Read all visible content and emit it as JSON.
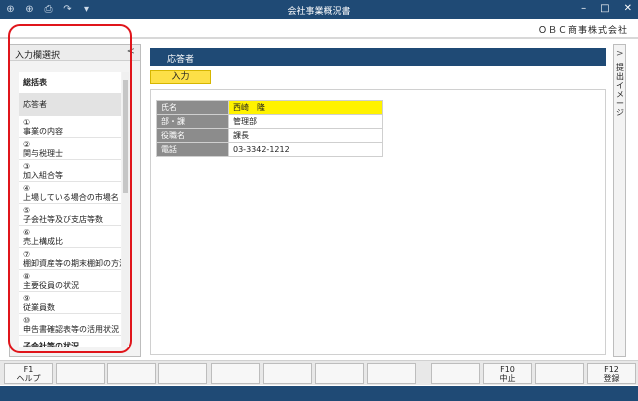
{
  "window": {
    "title": "会社事業概況書",
    "tools": [
      "⊕",
      "⊕",
      "⎙",
      "↷",
      "▾"
    ],
    "minimize": "–",
    "maximize": "□",
    "close": "✕"
  },
  "company": "ＯＢＣ商事株式会社",
  "left_panel": {
    "title": "入力欄選択",
    "collapse_glyph": "<",
    "items": [
      {
        "num": "",
        "label": "総括表",
        "bold": true
      },
      {
        "num": "",
        "label": "応答者",
        "selected": true
      },
      {
        "num": "①",
        "label": "事業の内容"
      },
      {
        "num": "②",
        "label": "関与税理士"
      },
      {
        "num": "③",
        "label": "加入組合等"
      },
      {
        "num": "④",
        "label": "上場している場合の市場名"
      },
      {
        "num": "⑤",
        "label": "子会社等及び支店等数"
      },
      {
        "num": "⑥",
        "label": "売上構成比"
      },
      {
        "num": "⑦",
        "label": "棚卸資産等の期末棚卸の方法"
      },
      {
        "num": "⑧",
        "label": "主要役員の状況"
      },
      {
        "num": "⑨",
        "label": "従業員数"
      },
      {
        "num": "⑩",
        "label": "申告書確認表等の活用状況"
      },
      {
        "num": "",
        "label": "子会社等の状況",
        "bold": true
      }
    ]
  },
  "main": {
    "section_title": "応答者",
    "input_button": "入力",
    "table": [
      {
        "label": "氏名",
        "value": "西崎　隆",
        "highlight": true
      },
      {
        "label": "部・課",
        "value": "管理部"
      },
      {
        "label": "役職名",
        "value": "課長"
      },
      {
        "label": "電話",
        "value": "03-3342-1212"
      }
    ]
  },
  "right_panel": {
    "chevron": ">",
    "label": "提出イメージ"
  },
  "function_keys": [
    {
      "key": "F1",
      "label": "ヘルプ"
    },
    {
      "key": "",
      "label": ""
    },
    {
      "key": "",
      "label": ""
    },
    {
      "key": "",
      "label": ""
    },
    {
      "key": "",
      "label": ""
    },
    {
      "key": "",
      "label": ""
    },
    {
      "key": "",
      "label": ""
    },
    {
      "key": "",
      "label": ""
    },
    {
      "key": "",
      "label": ""
    },
    {
      "key": "F10",
      "label": "中止"
    },
    {
      "key": "",
      "label": ""
    },
    {
      "key": "F12",
      "label": "登録"
    }
  ],
  "colors": {
    "navy": "#1f4a75",
    "input_yellow": "#fde047",
    "highlight_yellow": "#fff200",
    "annotation_red": "#e0151b"
  }
}
